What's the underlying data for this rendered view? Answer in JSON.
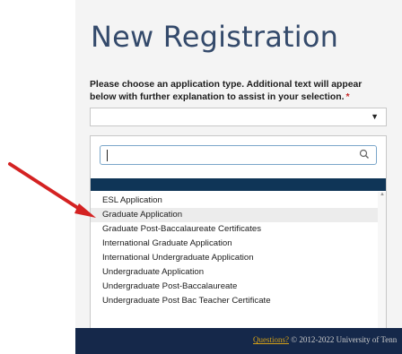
{
  "page": {
    "title": "New Registration",
    "prompt": "Please choose an application type. Additional text will appear below with further explanation to assist in your selection.",
    "required_mark": "*"
  },
  "select": {
    "value": "",
    "arrow_icon": "caret-down-icon"
  },
  "dropdown": {
    "search_value": "",
    "search_icon": "search-icon",
    "options": [
      "ESL Application",
      "Graduate Application",
      "Graduate Post-Baccalaureate Certificates",
      "International Graduate Application",
      "International Undergraduate Application",
      "Undergraduate Application",
      "Undergraduate Post-Baccalaureate",
      "Undergraduate Post Bac Teacher Certificate"
    ],
    "hovered_option": "Graduate Application"
  },
  "footer": {
    "link": "Questions?",
    "text": " © 2012-2022 University of Tenn"
  },
  "annotation": {
    "arrow_color": "#d42222"
  }
}
